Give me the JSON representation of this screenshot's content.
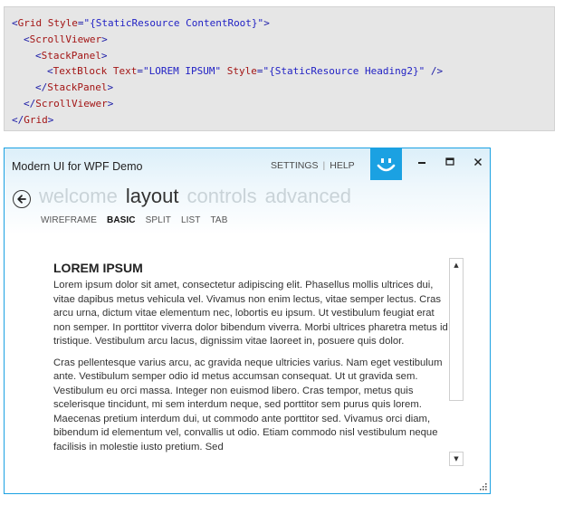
{
  "code": {
    "line1": {
      "lt": "<",
      "tag": "Grid",
      "attr": "Style",
      "val": "\"{StaticResource ContentRoot}\"",
      "gt": ">"
    },
    "line2": {
      "lt": "<",
      "tag": "ScrollViewer",
      "gt": ">"
    },
    "line3": {
      "lt": "<",
      "tag": "StackPanel",
      "gt": ">"
    },
    "line4": {
      "lt": "<",
      "tag": "TextBlock",
      "attr1": "Text",
      "val1": "\"LOREM IPSUM\"",
      "attr2": "Style",
      "val2": "\"{StaticResource Heading2}\"",
      "end": " />"
    },
    "line5": {
      "lt": "</",
      "tag": "StackPanel",
      "gt": ">"
    },
    "line6": {
      "lt": "</",
      "tag": "ScrollViewer",
      "gt": ">"
    },
    "line7": {
      "lt": "</",
      "tag": "Grid",
      "gt": ">"
    }
  },
  "window": {
    "title": "Modern UI for WPF Demo",
    "links": {
      "settings": "SETTINGS",
      "separator": "|",
      "help": "HELP"
    },
    "logo_icon": "smiley-icon",
    "controls": {
      "minimize": "−",
      "maximize": "□",
      "close": "×"
    }
  },
  "menu": {
    "items": [
      "welcome",
      "layout",
      "controls",
      "advanced"
    ],
    "active": "layout"
  },
  "submenu": {
    "items": [
      "WIREFRAME",
      "BASIC",
      "SPLIT",
      "LIST",
      "TAB"
    ],
    "active": "BASIC"
  },
  "content": {
    "heading": "LOREM IPSUM",
    "paragraph1": "Lorem ipsum dolor sit amet, consectetur adipiscing elit. Phasellus mollis ultrices dui, vitae dapibus metus vehicula vel. Vivamus non enim lectus, vitae semper lectus. Cras arcu urna, dictum vitae elementum nec, lobortis eu ipsum. Ut vestibulum feugiat erat non semper. In porttitor viverra dolor bibendum viverra. Morbi ultrices pharetra metus id tristique. Vestibulum arcu lacus, dignissim vitae laoreet in, posuere quis dolor.",
    "paragraph2": "Cras pellentesque varius arcu, ac gravida neque ultricies varius. Nam eget vestibulum ante. Vestibulum semper odio id metus accumsan consequat. Ut ut gravida sem. Vestibulum eu orci massa. Integer non euismod libero. Cras tempor, metus quis scelerisque tincidunt, mi sem interdum neque, sed porttitor sem purus quis lorem. Maecenas pretium interdum dui, ut commodo ante porttitor sed. Vivamus orci diam, bibendum id elementum vel, convallis ut odio. Etiam commodo nisl vestibulum neque facilisis in molestie iusto pretium. Sed"
  },
  "scrollbar": {
    "up": "▲",
    "down": "▼"
  },
  "colors": {
    "accent": "#1ba1e2",
    "code_bg": "#e6e6e6"
  }
}
